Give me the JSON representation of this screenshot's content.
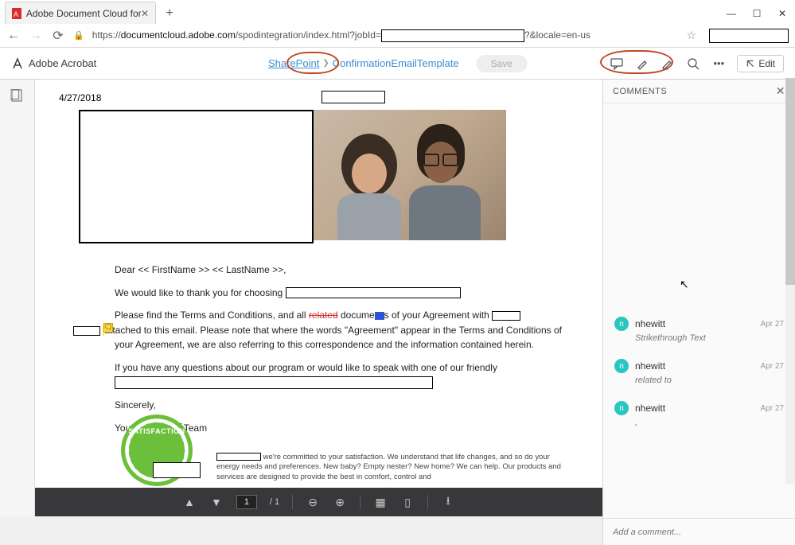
{
  "browser": {
    "tab_title": "Adobe Document Cloud for Sha",
    "url_prefix": "https://",
    "url_host": "documentcloud.adobe.com",
    "url_path": "/spodintegration/index.html?jobId=",
    "url_suffix": "?&locale=en-us"
  },
  "app": {
    "name": "Adobe Acrobat",
    "crumb1": "SharePoint",
    "crumb2": "ConfirmationEmailTemplate",
    "save": "Save",
    "edit": "Edit"
  },
  "doc": {
    "date": "4/27/2018",
    "greeting": "Dear << FirstName >> << LastName >>,",
    "p1_a": "We would like to thank you for choosing",
    "p2_a": "Please find the Terms and Conditions, and all ",
    "p2_strike": "related",
    "p2_b": " docume",
    "p2_c": "s of your Agreement with",
    "p2_d": " attached to this email. Please note that where the words \"Agreement\" appear in the Terms and Conditions of your Agreement, we are also referring to this correspondence and the information contained herein.",
    "p3": "If you have any questions about our program or would like to speak with one of our friendly",
    "closing": "Sincerely,",
    "sig_a": "Your",
    "sig_b": " Team",
    "satisfaction": "SATISFACTION",
    "footer": " we're committed to your satisfaction. We understand that life changes, and so do your energy needs and preferences. New baby? Empty nester? New home? We can help. Our products and services are designed to provide the best in comfort, control and"
  },
  "pager": {
    "current": "1",
    "total": "/ 1"
  },
  "comments": {
    "title": "COMMENTS",
    "items": [
      {
        "avatar": "n",
        "user": "nhewitt",
        "date": "Apr 27",
        "text": "Strikethrough Text"
      },
      {
        "avatar": "n",
        "user": "nhewitt",
        "date": "Apr 27",
        "text": "related to"
      },
      {
        "avatar": "n",
        "user": "nhewitt",
        "date": "Apr 27",
        "text": ","
      }
    ],
    "add_placeholder": "Add a comment..."
  }
}
